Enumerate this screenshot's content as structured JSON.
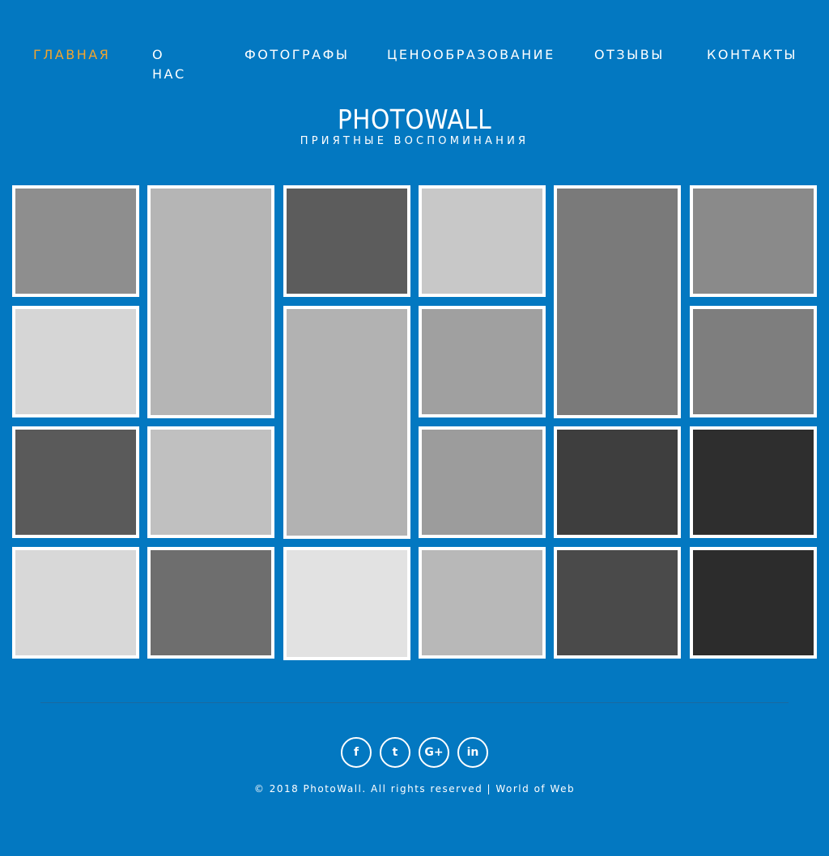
{
  "colors": {
    "background": "#0378c1",
    "nav_active": "#f3a52e",
    "text": "#ffffff",
    "tile_border": "#ffffff"
  },
  "nav": {
    "home": "ГЛАВНАЯ",
    "about_line1": "О",
    "about_line2": "НАС",
    "photographers": "ФОТОГРАФЫ",
    "pricing": "ЦЕНООБРАЗОВАНИЕ",
    "reviews": "ОТЗЫВЫ",
    "contacts": "КОНТАКТЫ",
    "active_item": "home"
  },
  "brand": {
    "title": "PHOTOWALL",
    "subtitle": "ПРИЯТНЫЕ ВОСПОМИНАНИЯ"
  },
  "gallery": {
    "photos": [
      {
        "name": "photo-woman-portrait",
        "tone": "#8e8e8e"
      },
      {
        "name": "photo-girl-beanie-holding-print",
        "tone": "#b5b5b5"
      },
      {
        "name": "photo-two-women-lying-faces",
        "tone": "#5c5c5c"
      },
      {
        "name": "photo-laughing-couple",
        "tone": "#c8c8c8"
      },
      {
        "name": "photo-wedding-couple-bouquet",
        "tone": "#7a7a7a"
      },
      {
        "name": "photo-wedding-couple-walking",
        "tone": "#8a8a8a"
      },
      {
        "name": "photo-man-hanging-photos",
        "tone": "#d6d6d6"
      },
      {
        "name": "photo-woman-wavy-hair",
        "tone": "#b2b2b2"
      },
      {
        "name": "photo-couple-sunglasses-lake",
        "tone": "#a0a0a0"
      },
      {
        "name": "photo-pregnant-couple",
        "tone": "#7e7e7e"
      },
      {
        "name": "photo-woman-sitting-sunglasses",
        "tone": "#5a5a5a"
      },
      {
        "name": "photo-three-girls-backs",
        "tone": "#c0c0c0"
      },
      {
        "name": "photo-couple-kissing-street",
        "tone": "#9c9c9c"
      },
      {
        "name": "photo-holding-hands-ring",
        "tone": "#3e3e3e"
      },
      {
        "name": "photo-mother-baby-window",
        "tone": "#2e2e2e"
      },
      {
        "name": "photo-babies-flower-wreath",
        "tone": "#d8d8d8"
      },
      {
        "name": "photo-little-girl-balloons",
        "tone": "#6e6e6e"
      },
      {
        "name": "photo-bird-on-hand-snow",
        "tone": "#e2e2e2"
      },
      {
        "name": "photo-pug-on-sofa",
        "tone": "#b8b8b8"
      },
      {
        "name": "photo-squirrel-on-tree",
        "tone": "#4a4a4a"
      },
      {
        "name": "photo-deer-in-forest",
        "tone": "#2c2c2c"
      }
    ]
  },
  "social": [
    {
      "name": "facebook-icon",
      "glyph": "f"
    },
    {
      "name": "twitter-icon",
      "glyph": "t"
    },
    {
      "name": "google-plus-icon",
      "glyph": "G+"
    },
    {
      "name": "linkedin-icon",
      "glyph": "in"
    }
  ],
  "footer": {
    "copyright": "© 2018 PhotoWall. All rights reserved | World of Web"
  }
}
